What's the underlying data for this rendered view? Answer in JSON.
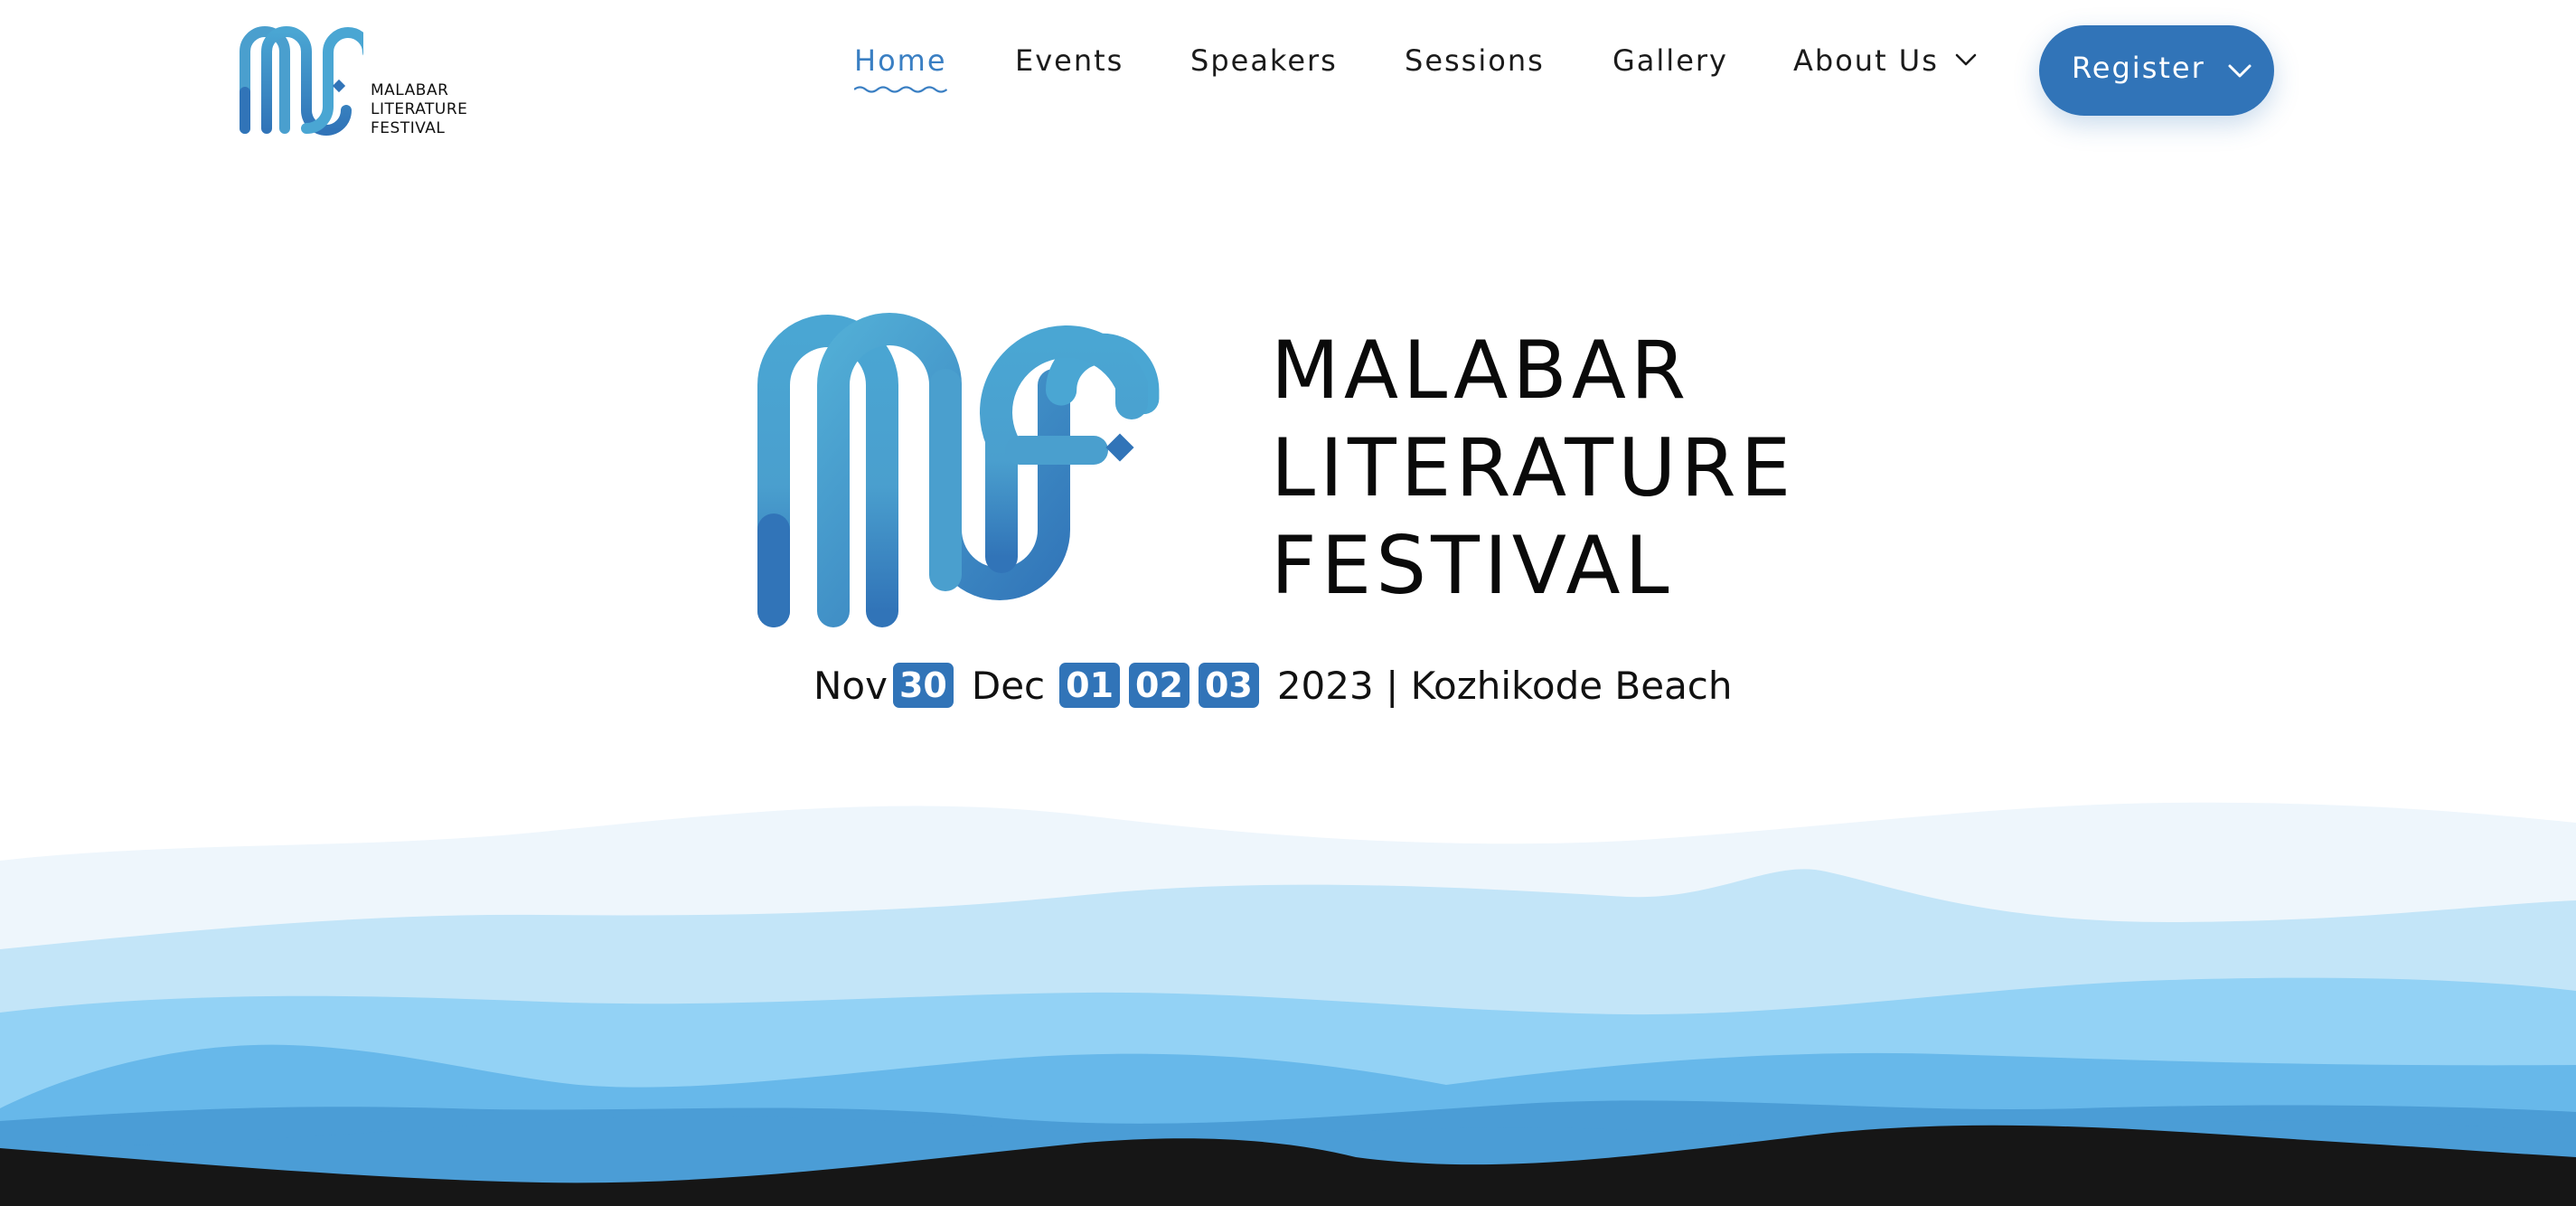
{
  "header": {
    "logo": {
      "monogram": "MLF",
      "text_lines": [
        "MALABAR",
        "LITERATURE",
        "FESTIVAL"
      ]
    },
    "nav": [
      {
        "label": "Home",
        "active": true
      },
      {
        "label": "Events",
        "active": false
      },
      {
        "label": "Speakers",
        "active": false
      },
      {
        "label": "Sessions",
        "active": false
      },
      {
        "label": "Gallery",
        "active": false
      },
      {
        "label": "About Us",
        "active": false,
        "icon": "chevron-down-icon"
      }
    ],
    "register": {
      "label": "Register",
      "icon": "chevron-down-icon"
    }
  },
  "hero": {
    "title_lines": [
      "MALABAR",
      "LITERATURE",
      "FESTIVAL"
    ],
    "dates": {
      "month1": "Nov",
      "month1_days": [
        "30"
      ],
      "month2": "Dec",
      "month2_days": [
        "01",
        "02",
        "03"
      ],
      "rest": "2023 | Kozhikode Beach"
    }
  },
  "colors": {
    "brand_blue": "#3174b8",
    "logo_light_blue": "#4a9fce",
    "nav_active": "#3a7fc3",
    "text_dark": "#111111",
    "wave_1": "#eef6fc",
    "wave_2": "#c3e5f8",
    "wave_3": "#93d2f5",
    "wave_4": "#67b8ea",
    "wave_5": "#4b9dd6",
    "ground": "#161616"
  }
}
